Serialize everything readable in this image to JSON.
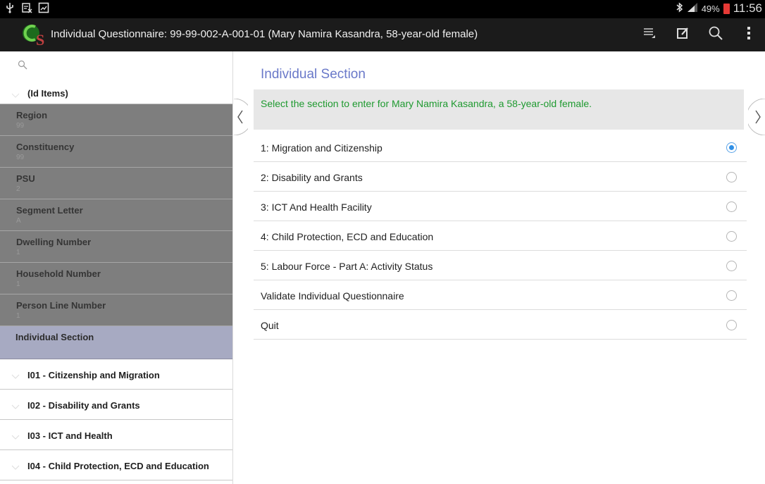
{
  "status_bar": {
    "battery_percent": "49%",
    "time": "11:56",
    "battery_color": "#e53935"
  },
  "action_bar": {
    "title": "Individual Questionnaire: 99-99-002-A-001-01 (Mary Namira Kasandra, 58-year-old female)",
    "logo_text": "CS",
    "icons": [
      "menu-list-icon",
      "edit-icon",
      "search-icon",
      "overflow-menu-icon"
    ]
  },
  "left_panel": {
    "id_header": "(Id Items)",
    "id_items": [
      {
        "label": "Region",
        "value": "99"
      },
      {
        "label": "Constituency",
        "value": "99"
      },
      {
        "label": "PSU",
        "value": "2"
      },
      {
        "label": "Segment Letter",
        "value": "A"
      },
      {
        "label": "Dwelling Number",
        "value": "1"
      },
      {
        "label": "Household Number",
        "value": "1"
      },
      {
        "label": "Person Line Number",
        "value": "1"
      }
    ],
    "selected_section": "Individual Section",
    "groups": [
      "I01 - Citizenship and Migration",
      "I02 - Disability and Grants",
      "I03 - ICT and Health",
      "I04 - Child Protection, ECD and Education"
    ]
  },
  "main": {
    "section_title": "Individual Section",
    "message": "Select the section to enter for Mary Namira Kasandra, a 58-year-old female.",
    "options": [
      {
        "label": "1: Migration and Citizenship",
        "selected": true
      },
      {
        "label": "2: Disability and Grants",
        "selected": false
      },
      {
        "label": "3: ICT And Health Facility",
        "selected": false
      },
      {
        "label": "4: Child Protection, ECD and Education",
        "selected": false
      },
      {
        "label": "5: Labour Force - Part A: Activity Status",
        "selected": false
      },
      {
        "label": "Validate Individual Questionnaire",
        "selected": false
      },
      {
        "label": "Quit",
        "selected": false
      }
    ]
  },
  "colors": {
    "title_accent": "#6a79c9",
    "message_text": "#1f9a30",
    "radio_selected": "#2f8fe6",
    "selected_row": "#a7aac2"
  }
}
